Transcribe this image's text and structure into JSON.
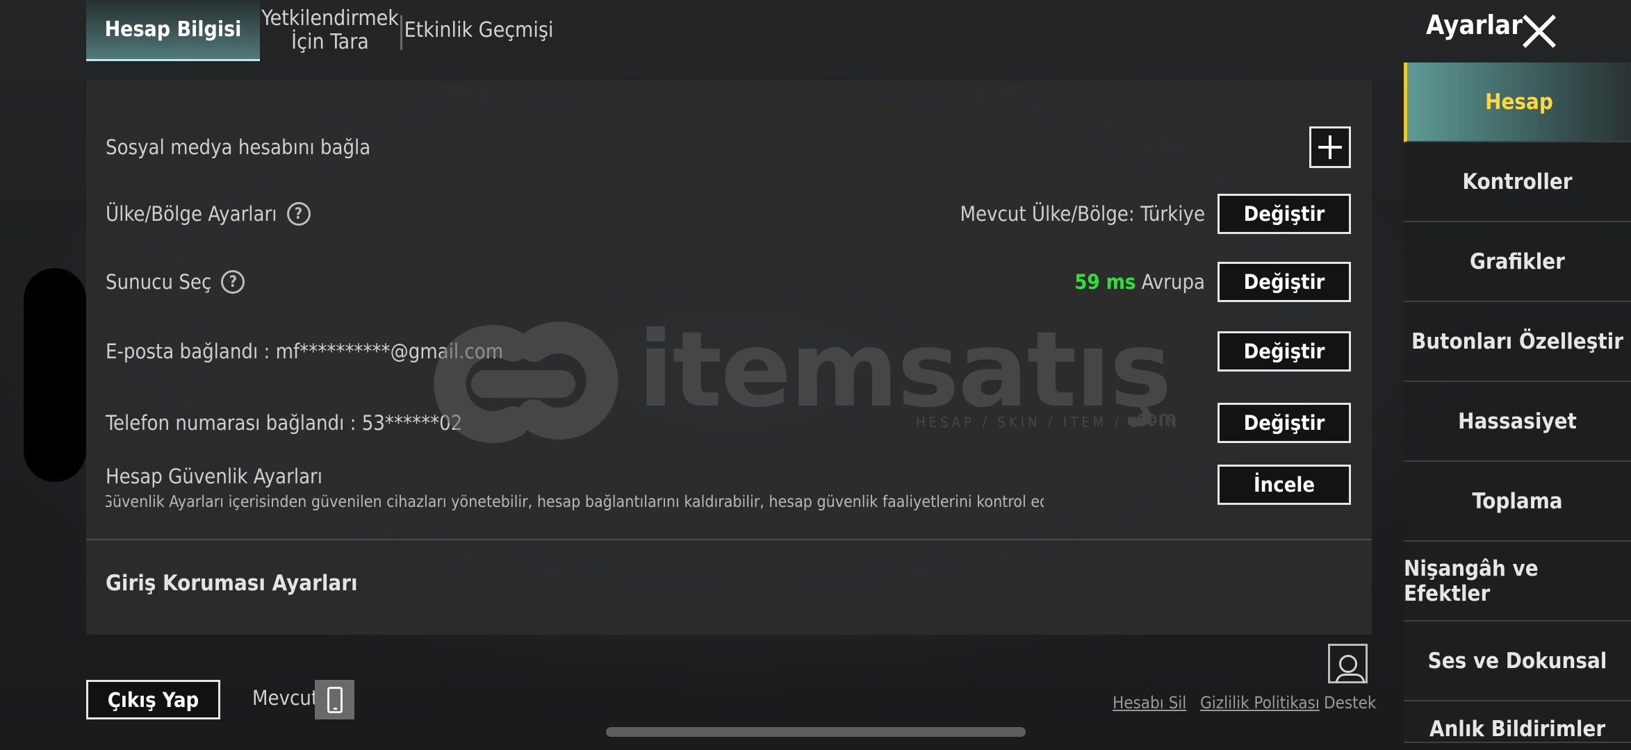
{
  "tabs": [
    {
      "label": "Hesap Bilgisi"
    },
    {
      "label": "Yetkilendirmek İçin Tara"
    },
    {
      "label": "Etkinlik Geçmişi"
    }
  ],
  "header": {
    "title": "Ayarlar"
  },
  "rows": {
    "social": {
      "label": "Sosyal medya hesabını bağla"
    },
    "region": {
      "label": "Ülke/Bölge Ayarları",
      "value": "Mevcut Ülke/Bölge: Türkiye",
      "button": "Değiştir"
    },
    "server": {
      "label": "Sunucu Seç",
      "ping": "59 ms",
      "region": "Avrupa",
      "button": "Değiştir"
    },
    "email": {
      "label": "E-posta bağlandı : mf**********@gmail.com",
      "button": "Değiştir"
    },
    "phone": {
      "label": "Telefon numarası bağlandı : 53******02",
      "button": "Değiştir"
    },
    "security": {
      "label": "Hesap Güvenlik Ayarları",
      "description": "Güvenlik Ayarları içerisinden güvenilen cihazları yönetebilir, hesap bağlantılarını kaldırabilir, hesap güvenlik faaliyetlerini kontrol edebilir ve",
      "button": "İncele"
    },
    "login_protection": {
      "title": "Giriş Koruması Ayarları"
    }
  },
  "watermark": {
    "brand": "itemsatış",
    "tagline": "HESAP / SKIN / ITEM / E-PIN",
    "domain": ".com"
  },
  "sidebar": {
    "items": [
      {
        "label": "Hesap",
        "active": true
      },
      {
        "label": "Kontroller"
      },
      {
        "label": "Grafikler"
      },
      {
        "label": "Butonları Özelleştir"
      },
      {
        "label": "Hassasiyet"
      },
      {
        "label": "Toplama"
      },
      {
        "label": "Nişangâh ve Efektler"
      },
      {
        "label": "Ses ve Dokunsal"
      },
      {
        "label": "Anlık Bildirimler"
      }
    ]
  },
  "footer": {
    "logout": "Çıkış Yap",
    "current_device": "Mevcut",
    "delete_account": "Hesabı Sil",
    "privacy_policy": "Gizlilik Politikası",
    "support": "Destek"
  },
  "colors": {
    "ping_green": "#2ee03a",
    "active_sidebar_text": "#ffd93a",
    "active_tab_underline": "#b9f0ee"
  }
}
